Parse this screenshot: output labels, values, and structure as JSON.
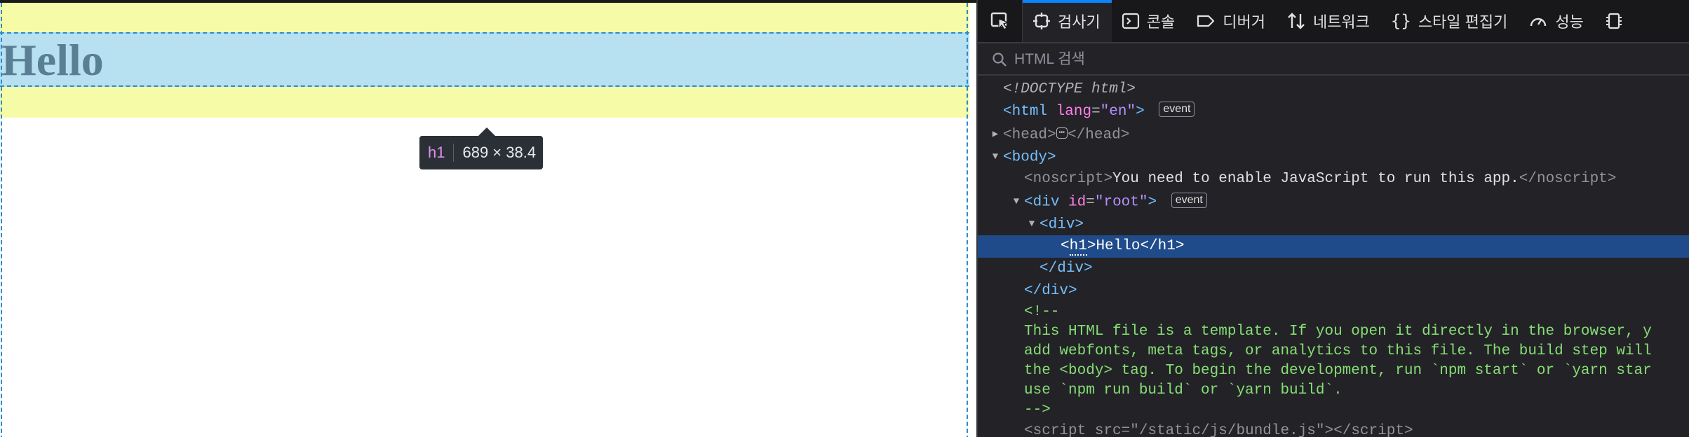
{
  "page": {
    "heading": "Hello"
  },
  "tooltip": {
    "tag": "h1",
    "dimensions": "689 × 38.4"
  },
  "devtools": {
    "tabs": [
      {
        "label": "검사기",
        "icon": "inspector-icon",
        "active": true
      },
      {
        "label": "콘솔",
        "icon": "console-icon",
        "active": false
      },
      {
        "label": "디버거",
        "icon": "debugger-icon",
        "active": false
      },
      {
        "label": "네트워크",
        "icon": "network-icon",
        "active": false
      },
      {
        "label": "스타일 편집기",
        "icon": "style-editor-icon",
        "active": false
      },
      {
        "label": "성능",
        "icon": "performance-icon",
        "active": false
      }
    ],
    "search": {
      "placeholder": "HTML 검색"
    },
    "tree": {
      "doctype": "<!DOCTYPE html>",
      "html_tag": "html",
      "html_attr_name": "lang",
      "html_attr_value": "\"en\"",
      "event_badge": "event",
      "head_tag": "head",
      "body_tag": "body",
      "noscript_tag": "noscript",
      "noscript_text": "You need to enable JavaScript to run this app.",
      "div_tag": "div",
      "div_attr_name": "id",
      "div_attr_value": "\"root\"",
      "h1_tag": "h1",
      "h1_text": "Hello",
      "comment_open": "<!--",
      "comment_lines": [
        "This HTML file is a template. If you open it directly in the browser, y",
        "add webfonts, meta tags, or analytics to this file. The build step will",
        "the <body> tag. To begin the development, run `npm start` or `yarn star",
        "use `npm run build` or `yarn build`."
      ],
      "comment_close": "-->",
      "script_tag": "script",
      "script_attr_name": "src",
      "script_attr_value": "\"/static/js/bundle.js\""
    }
  },
  "colors": {
    "margin": "#f6fba7",
    "content": "#b7e0f0",
    "selection": "#1f4b8a",
    "accent": "#0a84ff"
  }
}
